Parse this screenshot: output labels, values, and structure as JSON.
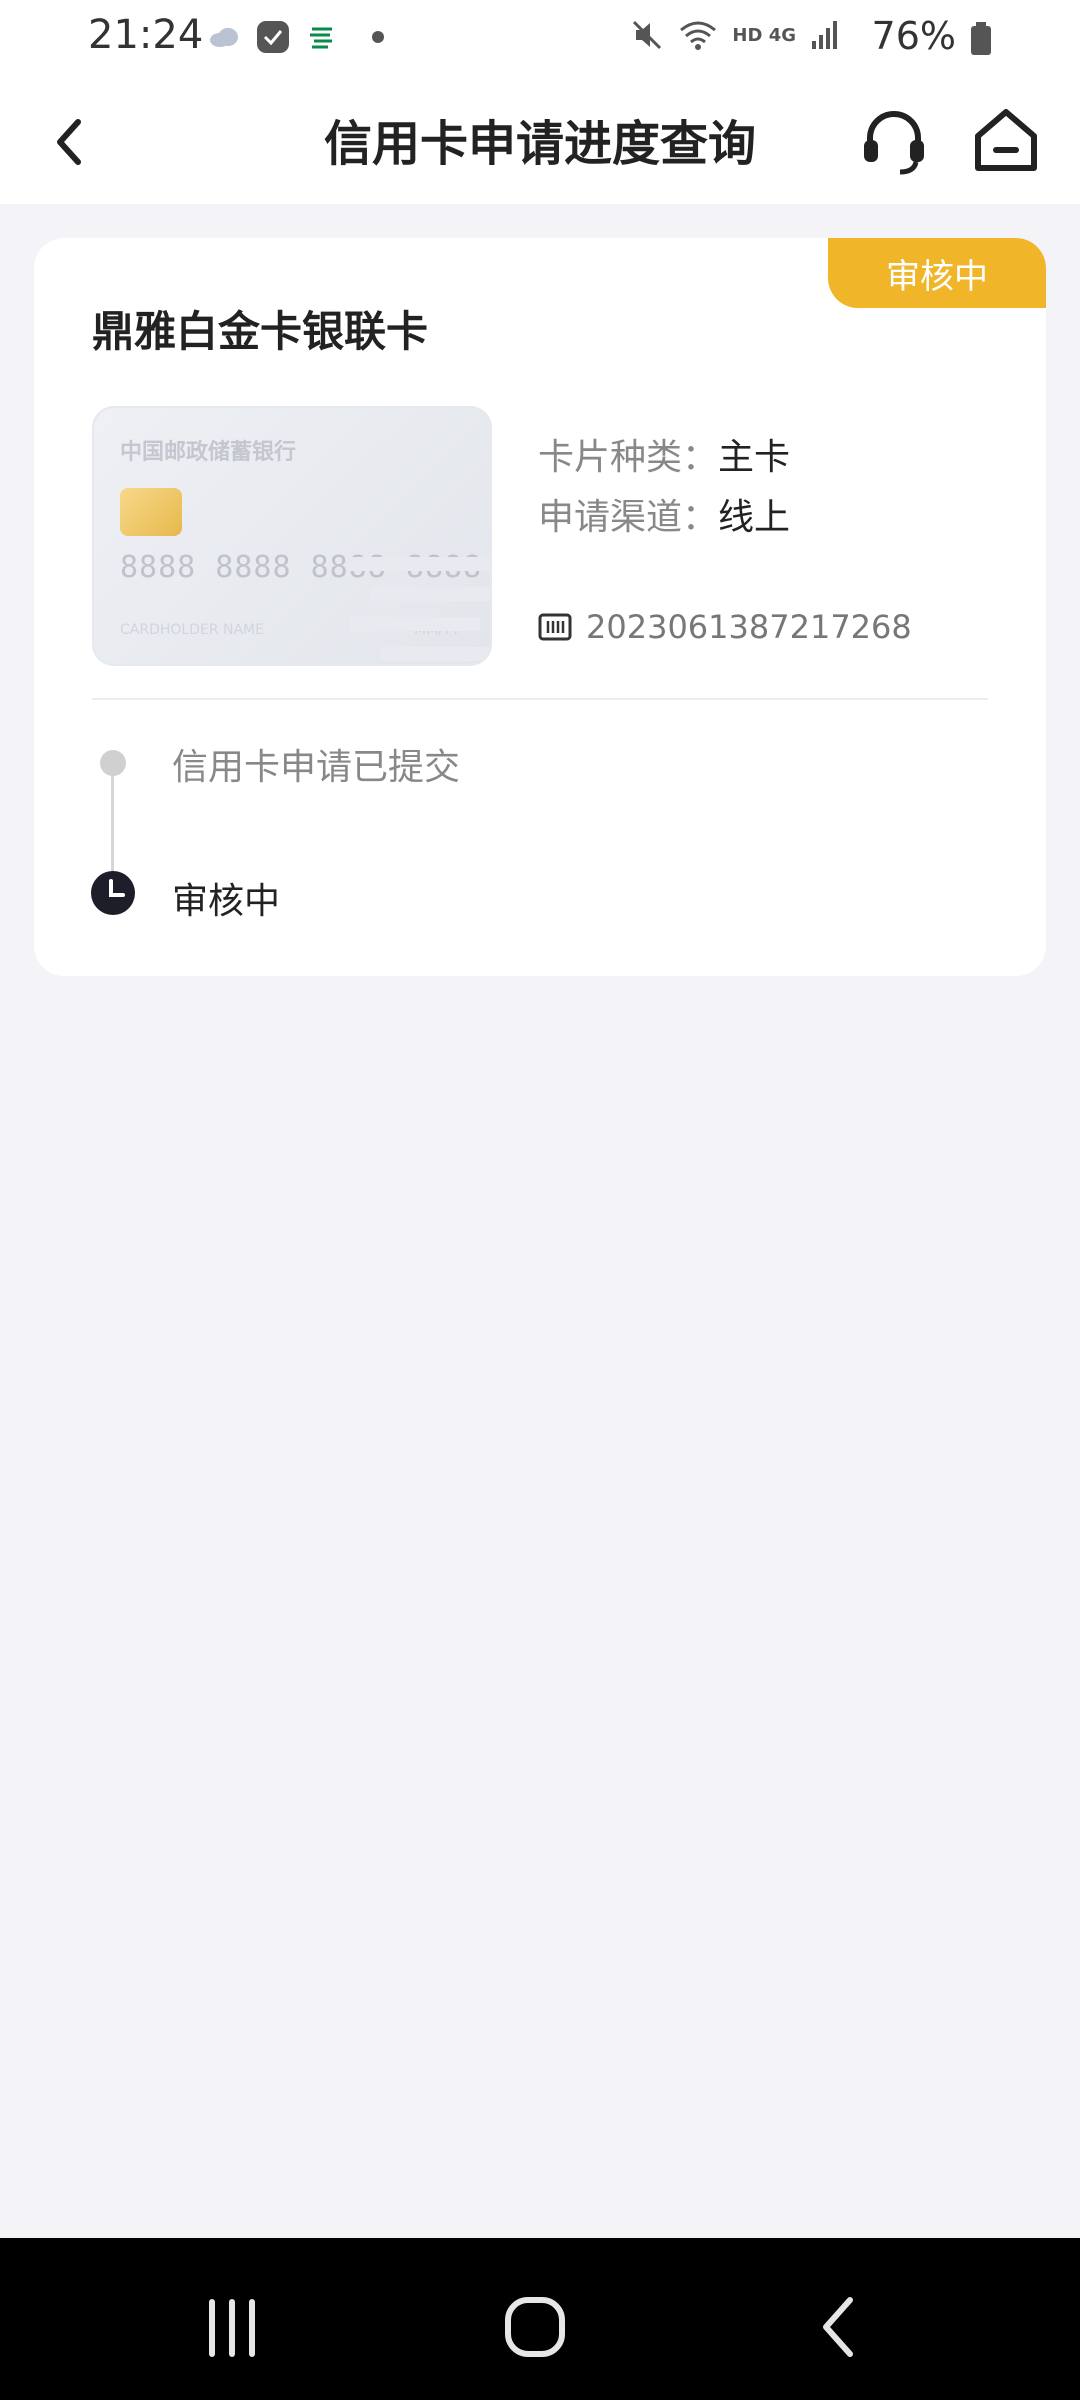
{
  "status_bar": {
    "time": "21:24",
    "battery": "76%",
    "network": "HD 4G",
    "icons": [
      "cloud-icon",
      "app-check-icon",
      "bank-logo-icon",
      "dot-icon",
      "mute-icon",
      "wifi-icon",
      "signal-icon",
      "battery-icon"
    ]
  },
  "header": {
    "title": "信用卡申请进度查询",
    "icons": [
      "back-icon",
      "headset-icon",
      "home-icon"
    ]
  },
  "application": {
    "status_badge": "审核中",
    "card_name": "鼎雅白金卡银联卡",
    "card_image": {
      "bank_name": "中国邮政储蓄银行",
      "number": "8888 8888 8888 8888",
      "holder": "CARDHOLDER NAME",
      "expiry": "MM/YY"
    },
    "card_type_label": "卡片种类：",
    "card_type_value": "主卡",
    "channel_label": "申请渠道：",
    "channel_value": "线上",
    "application_number": "2023061387217268"
  },
  "timeline": [
    {
      "text": "信用卡申请已提交",
      "state": "done"
    },
    {
      "text": "审核中",
      "state": "current"
    }
  ],
  "colors": {
    "accent": "#f0b529",
    "background": "#f3f3f8",
    "card": "#ffffff"
  },
  "nav_bar": {
    "icons": [
      "recents-icon",
      "home-circle-icon",
      "nav-back-icon"
    ]
  }
}
